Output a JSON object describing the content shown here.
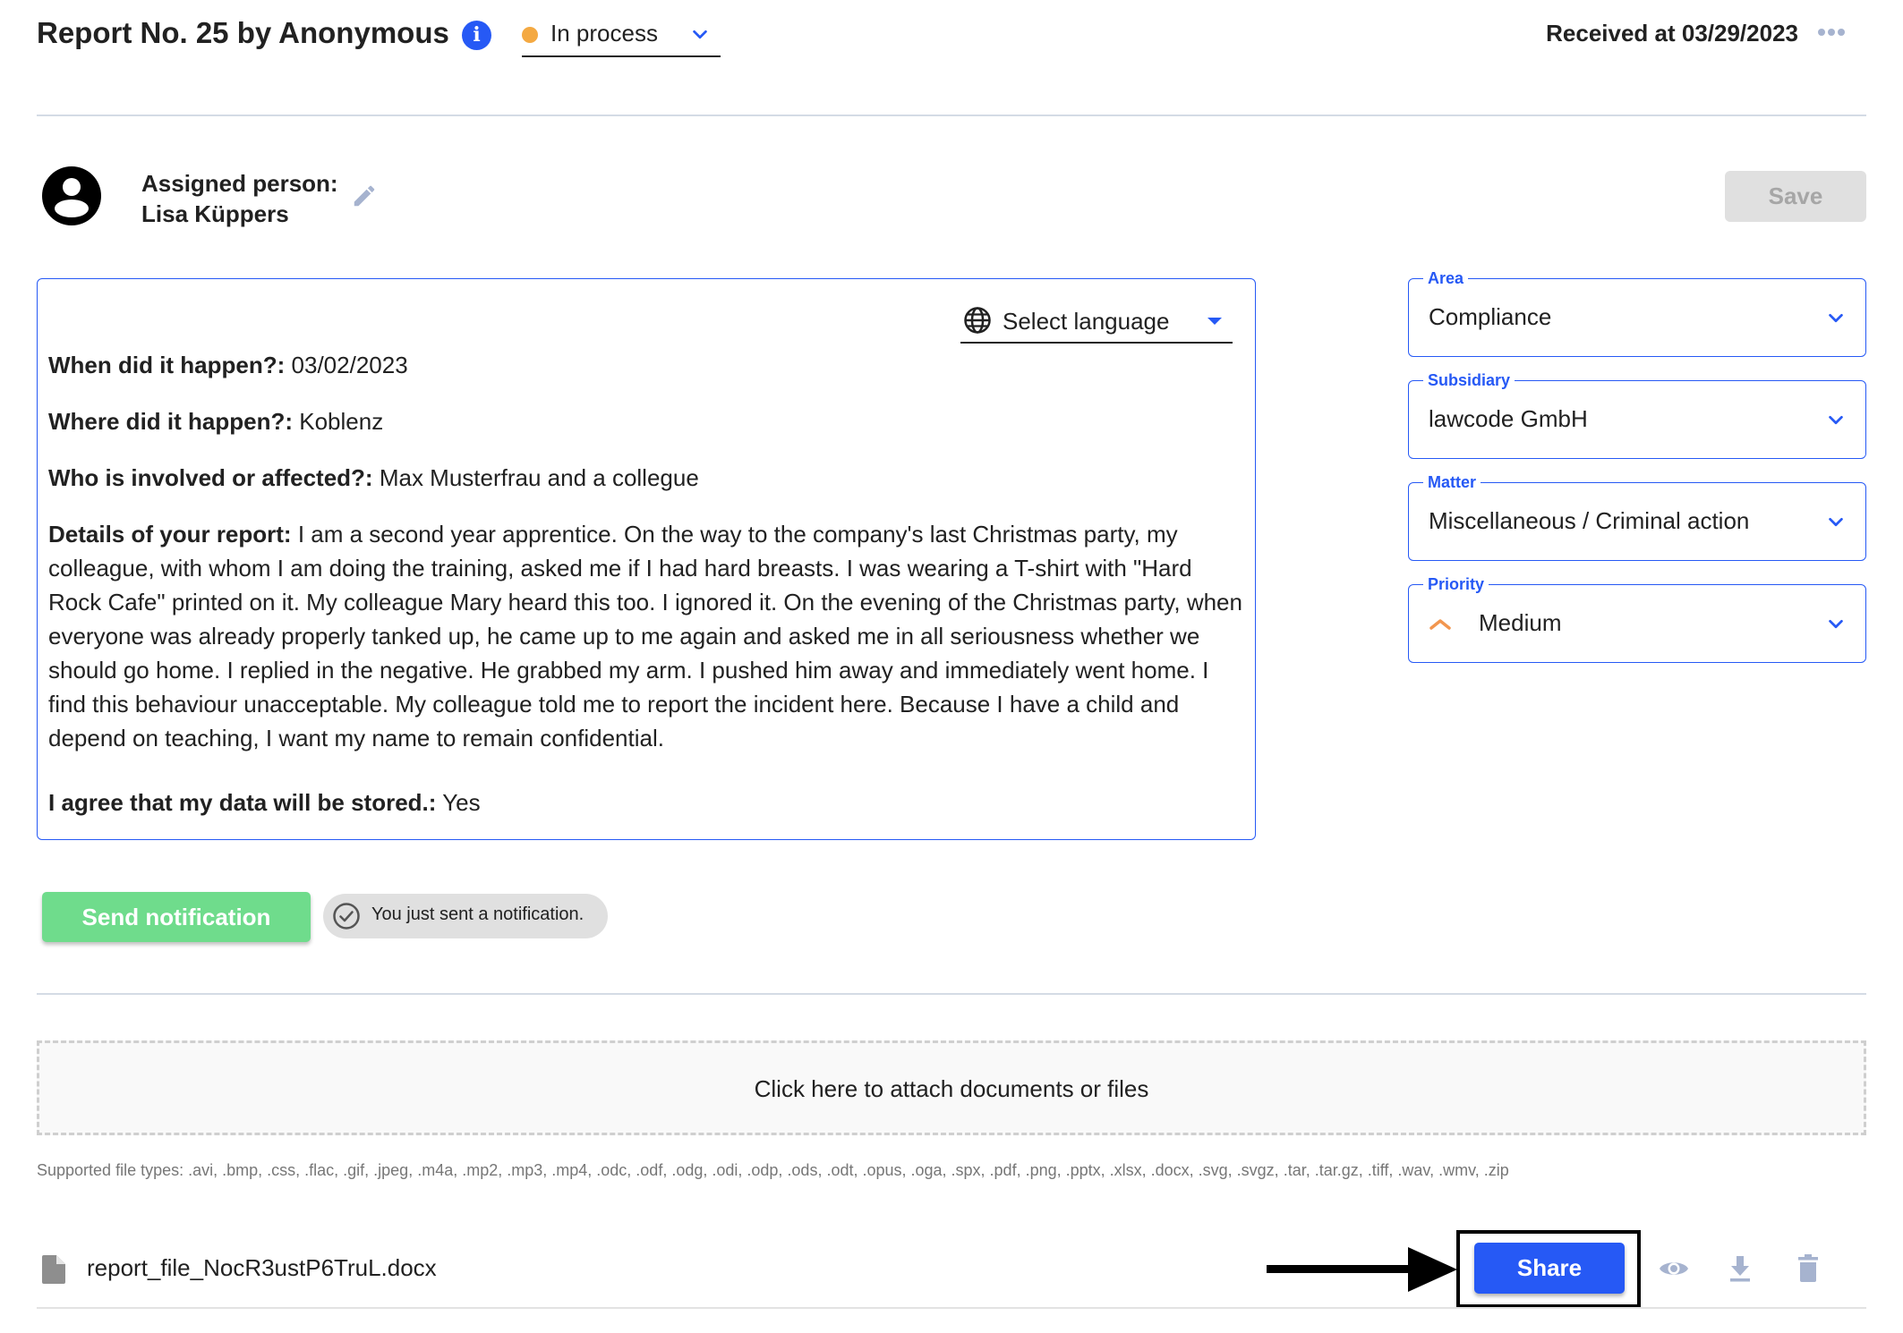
{
  "header": {
    "title": "Report No. 25 by Anonymous",
    "status": {
      "label": "In process",
      "color": "#f4a942"
    },
    "received": "Received at 03/29/2023"
  },
  "assigned": {
    "label": "Assigned person:",
    "name": "Lisa Küppers"
  },
  "toolbar": {
    "save_label": "Save"
  },
  "report": {
    "language_select": "Select language",
    "entries": [
      {
        "question": "When did it happen?:",
        "answer": "03/02/2023"
      },
      {
        "question": "Where did it happen?:",
        "answer": "Koblenz"
      },
      {
        "question": "Who is involved or affected?:",
        "answer": "Max Musterfrau and a collegue"
      },
      {
        "question": "Details of your report:",
        "answer": "I am a second year apprentice. On the way to the company's last Christmas party, my colleague, with whom I am doing the training, asked me if I had hard breasts. I was wearing a T-shirt with \"Hard Rock Cafe\" printed on it. My colleague Mary heard this too. I ignored it. On the evening of the Christmas party, when everyone was already properly tanked up, he came up to me again and asked me in all seriousness whether we should go home. I replied in the negative. He grabbed my arm. I pushed him away and immediately went home. I find this behaviour unacceptable. My colleague told me to report the incident here. Because I have a child and depend on teaching, I want my name to remain confidential."
      },
      {
        "question": "I agree that my data will be stored.:",
        "answer": "Yes"
      }
    ]
  },
  "fields": [
    {
      "legend": "Area",
      "value": "Compliance"
    },
    {
      "legend": "Subsidiary",
      "value": "lawcode GmbH"
    },
    {
      "legend": "Matter",
      "value": "Miscellaneous / Criminal action"
    },
    {
      "legend": "Priority",
      "value": "Medium",
      "icon": "chevron-up-icon",
      "icon_color": "#f2964f"
    }
  ],
  "notification": {
    "send_label": "Send notification",
    "toast": "You just sent a notification."
  },
  "attachments": {
    "dropzone": "Click here to attach documents or files",
    "supported": "Supported file types: .avi, .bmp, .css, .flac, .gif, .jpeg, .m4a, .mp2, .mp3, .mp4, .odc, .odf, .odg, .odi, .odp, .ods, .odt, .opus, .oga, .spx, .pdf, .png, .pptx, .xlsx, .docx, .svg, .svgz, .tar, .tar.gz, .tiff, .wav, .wmv, .zip",
    "files": [
      {
        "name": "report_file_NocR3ustP6TruL.docx",
        "share_label": "Share"
      }
    ]
  },
  "colors": {
    "accent": "#2659f5",
    "success": "#6fdc8c",
    "muted_icon": "#a6b3cf",
    "status_in_process": "#f4a942"
  }
}
